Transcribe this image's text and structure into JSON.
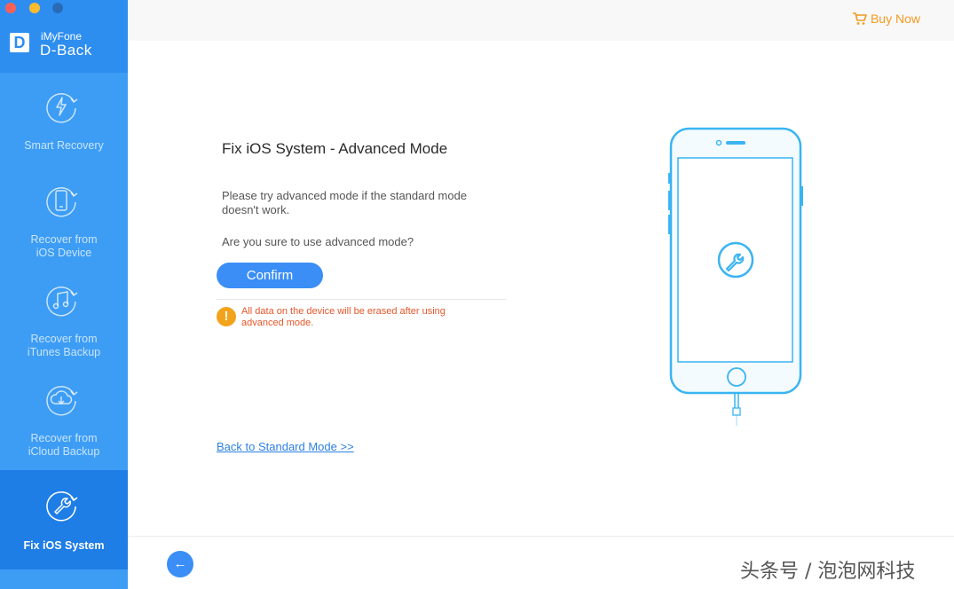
{
  "app": {
    "brand_small": "iMyFone",
    "brand_large": "D-Back",
    "logo_letter": "D"
  },
  "sidebar": {
    "items": [
      {
        "label": "Smart Recovery",
        "icon": "lightning-refresh-icon",
        "active": false
      },
      {
        "label": "Recover from\niOS Device",
        "icon": "phone-refresh-icon",
        "active": false
      },
      {
        "label": "Recover from\niTunes Backup",
        "icon": "music-note-refresh-icon",
        "active": false
      },
      {
        "label": "Recover from\niCloud Backup",
        "icon": "cloud-download-refresh-icon",
        "active": false
      },
      {
        "label": "Fix iOS System",
        "icon": "wrench-refresh-icon",
        "active": true
      }
    ]
  },
  "topbar": {
    "buy_label": "Buy Now",
    "buy_icon": "cart-icon"
  },
  "main": {
    "title": "Fix iOS System - Advanced Mode",
    "description": "Please try advanced mode if the standard mode doesn't work.",
    "question": "Are you sure to use advanced mode?",
    "confirm_label": "Confirm",
    "warning_icon": "!",
    "warning_text": "All data on the device will be erased after using advanced mode.",
    "back_link": "Back to Standard Mode >>"
  },
  "footer": {
    "back_icon": "←"
  },
  "watermark": "头条号 / 泡泡网科技",
  "colors": {
    "sidebar": "#3d9df5",
    "sidebar_active": "#1f7de6",
    "accent": "#3a8ef6",
    "buy": "#f39a1e",
    "warning": "#e5562a",
    "phone_outline": "#3ab4f2"
  }
}
